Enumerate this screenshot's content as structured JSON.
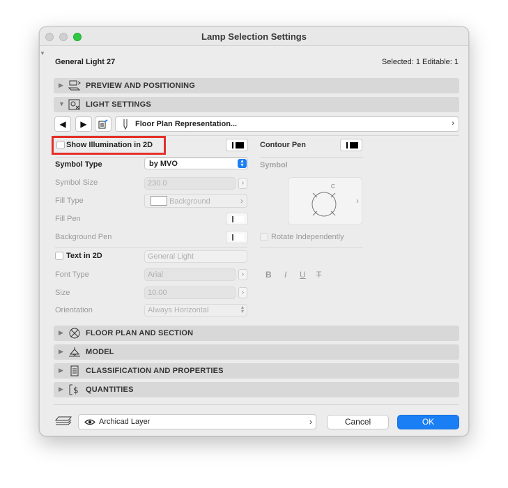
{
  "window": {
    "title": "Lamp Selection Settings"
  },
  "header": {
    "object_name": "General Light 27",
    "selection_info": "Selected: 1 Editable: 1"
  },
  "sections": {
    "preview": "PREVIEW AND POSITIONING",
    "light": "LIGHT SETTINGS",
    "floor_plan": "FLOOR PLAN AND SECTION",
    "model": "MODEL",
    "classification": "CLASSIFICATION AND PROPERTIES",
    "quantities": "QUANTITIES"
  },
  "page_nav": {
    "current_page": "Floor Plan Representation..."
  },
  "illumination": {
    "label": "Show Illumination in 2D",
    "checked": false
  },
  "contour_pen": {
    "label": "Contour Pen"
  },
  "symbol_type": {
    "label": "Symbol Type",
    "value": "by MVO"
  },
  "symbol": {
    "label": "Symbol",
    "preview_letter": "C"
  },
  "symbol_size": {
    "label": "Symbol Size",
    "value": "230.0"
  },
  "fill_type": {
    "label": "Fill Type",
    "value": "Background"
  },
  "fill_pen": {
    "label": "Fill Pen"
  },
  "background_pen": {
    "label": "Background Pen"
  },
  "rotate": {
    "label": "Rotate Independently"
  },
  "text2d": {
    "label": "Text in 2D",
    "value": "General Light"
  },
  "font_type": {
    "label": "Font Type",
    "value": "Arial"
  },
  "size": {
    "label": "Size",
    "value": "10.00"
  },
  "orientation": {
    "label": "Orientation",
    "value": "Always Horizontal"
  },
  "style_buttons": {
    "bold": "B",
    "italic": "I",
    "underline": "U",
    "strike": "T"
  },
  "footer": {
    "layer": "Archicad Layer",
    "cancel": "Cancel",
    "ok": "OK"
  },
  "colors": {
    "accent": "#1a7ef5",
    "highlight": "#e4302a"
  },
  "icons": {
    "preview": "preview-positioning-icon",
    "light": "light-settings-icon",
    "floor_plan": "floor-plan-icon",
    "model": "lamp-model-icon",
    "classification": "classification-icon",
    "quantities": "quantities-icon",
    "layer": "layer-icon",
    "eye": "eye-icon"
  }
}
